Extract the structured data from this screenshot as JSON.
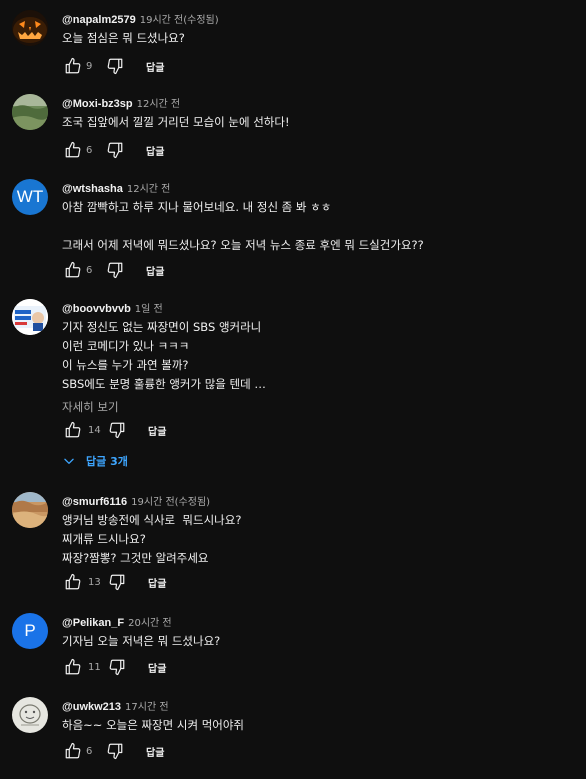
{
  "comments": [
    {
      "author": "@napalm2579",
      "time": "19시간 전(수정됨)",
      "avatar_icon": "jack-o-lantern-avatar",
      "text": [
        "오늘 점심은 뭐 드셨나요?"
      ],
      "likes": "9",
      "reply_label": "답글"
    },
    {
      "author": "@Moxi-bz3sp",
      "time": "12시간 전",
      "avatar_icon": "landscape-photo-avatar",
      "text": [
        "조국 집앞에서 낄낄 거리던 모습이 눈에 선하다!"
      ],
      "likes": "6",
      "reply_label": "답글"
    },
    {
      "author": "@wtshasha",
      "time": "12시간 전",
      "avatar_letter": "WT",
      "avatar_color": "#1976d2",
      "text": [
        "아참 깜빡하고 하루 지나 물어보네요. 내 정신 좀 봐 ㅎㅎ",
        "",
        "그래서 어제 저녁에 뭐드셨나요? 오늘 저녁 뉴스 종료 후엔 뭐 드실건가요??"
      ],
      "likes": "6",
      "reply_label": "답글"
    },
    {
      "author": "@boovvbvvb",
      "time": "1일 전",
      "avatar_icon": "campaign-poster-avatar",
      "avatar_text": "이재명은 지켜냅니다",
      "text": [
        "기자 정신도 없는 짜장면이 SBS 앵커라니",
        "이런 코메디가 있나 ㅋㅋㅋ",
        "이 뉴스를 누가 과연 볼까?",
        "SBS에도 분명 훌륭한 앵커가 많을 텐데 …"
      ],
      "more_label": "자세히 보기",
      "likes": "14",
      "reply_label": "답글",
      "replies_label": "답글 3개"
    },
    {
      "author": "@smurf6116",
      "time": "19시간 전(수정됨)",
      "avatar_icon": "desert-photo-avatar",
      "text": [
        "앵커님 방송전에 식사로  뭐드시나요?",
        "찌개류 드시나요?",
        "짜장?짬뽕? 그것만 알려주세요"
      ],
      "likes": "13",
      "reply_label": "답글"
    },
    {
      "author": "@Pelikan_F",
      "time": "20시간 전",
      "avatar_letter": "P",
      "avatar_color": "#1a73e8",
      "text": [
        "기자님 오늘 저녁은 뭐 드셨나요?"
      ],
      "likes": "11",
      "reply_label": "답글"
    },
    {
      "author": "@uwkw213",
      "time": "17시간 전",
      "avatar_icon": "sketch-drawing-avatar",
      "text": [
        "하음~~ 오늘은 짜장면 시켜 먹어야쥐"
      ],
      "likes": "6",
      "reply_label": "답글"
    }
  ]
}
